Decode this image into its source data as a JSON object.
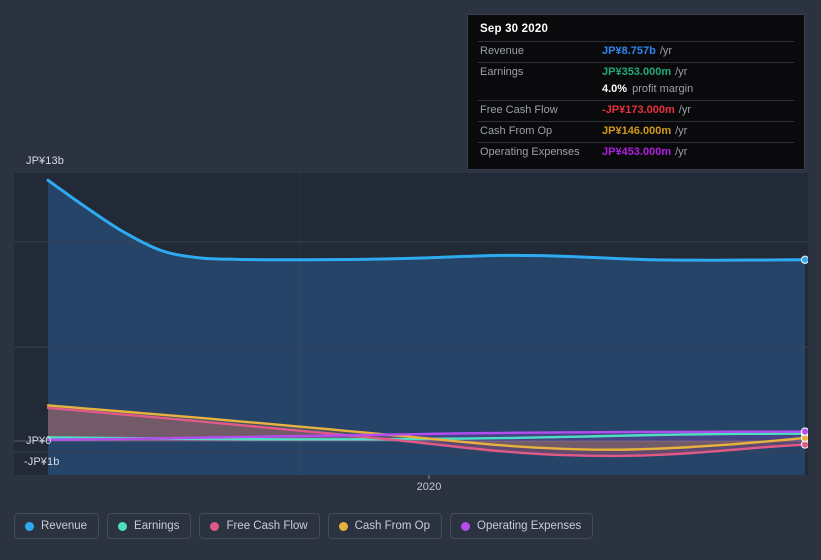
{
  "chart_data": {
    "type": "area",
    "title": "",
    "xlabel": "",
    "ylabel": "",
    "currency": "JP¥",
    "grid": true,
    "legend_position": "bottom",
    "ylim": [
      -1.0,
      13.0
    ],
    "y_ticks": [
      {
        "value": 13.0,
        "label": "JP¥13b"
      },
      {
        "value": 0.0,
        "label": "JP¥0"
      },
      {
        "value": -1.0,
        "label": "-JP¥1b"
      }
    ],
    "x_ticks": [
      {
        "label": "2020"
      }
    ],
    "x_range": [
      "2017",
      "2020-09-30"
    ],
    "series": [
      {
        "name": "Revenue",
        "color": "#2eabf0",
        "fill": "#27456a",
        "unit": "JP¥b",
        "values": [
          12.6,
          11.3,
          10.1,
          9.2,
          8.85,
          8.78,
          8.76,
          8.76,
          8.77,
          8.8,
          8.85,
          8.92,
          8.97,
          8.96,
          8.9,
          8.82,
          8.76,
          8.74,
          8.74,
          8.75,
          8.757
        ]
      },
      {
        "name": "Earnings",
        "color": "#4edfc2",
        "unit": "JP¥b",
        "values": [
          0.18,
          0.16,
          0.14,
          0.12,
          0.1,
          0.09,
          0.08,
          0.08,
          0.08,
          0.09,
          0.1,
          0.12,
          0.14,
          0.17,
          0.21,
          0.25,
          0.29,
          0.32,
          0.34,
          0.35,
          0.353
        ]
      },
      {
        "name": "Free Cash Flow",
        "color": "#e05a87",
        "unit": "JP¥b",
        "values": [
          1.6,
          1.44,
          1.28,
          1.12,
          0.95,
          0.78,
          0.61,
          0.44,
          0.26,
          0.08,
          -0.12,
          -0.32,
          -0.5,
          -0.63,
          -0.7,
          -0.72,
          -0.68,
          -0.58,
          -0.44,
          -0.29,
          -0.173
        ]
      },
      {
        "name": "Cash From Op",
        "color": "#e8b23f",
        "unit": "JP¥b",
        "values": [
          1.72,
          1.57,
          1.42,
          1.27,
          1.12,
          0.96,
          0.8,
          0.64,
          0.47,
          0.3,
          0.13,
          -0.05,
          -0.21,
          -0.33,
          -0.4,
          -0.42,
          -0.38,
          -0.29,
          -0.17,
          -0.02,
          0.146
        ]
      },
      {
        "name": "Operating Expenses",
        "color": "#b44df0",
        "unit": "JP¥b",
        "values": [
          0.06,
          0.08,
          0.1,
          0.13,
          0.16,
          0.19,
          0.22,
          0.25,
          0.28,
          0.31,
          0.34,
          0.37,
          0.39,
          0.41,
          0.42,
          0.43,
          0.44,
          0.44,
          0.45,
          0.45,
          0.453
        ]
      }
    ]
  },
  "tooltip": {
    "date": "Sep 30 2020",
    "rows": [
      {
        "key": "Revenue",
        "value": "JP¥8.757b",
        "unit": "/yr",
        "color": "#2e87f0",
        "sub": ""
      },
      {
        "key": "Earnings",
        "value": "JP¥353.000m",
        "unit": "/yr",
        "color": "#1fa87a",
        "sub": ""
      },
      {
        "key": "",
        "value": "4.0%",
        "unit": "",
        "color": "#ffffff",
        "sub": "profit margin"
      },
      {
        "key": "Free Cash Flow",
        "value": "-JP¥173.000m",
        "unit": "/yr",
        "color": "#e8323c",
        "sub": ""
      },
      {
        "key": "Cash From Op",
        "value": "JP¥146.000m",
        "unit": "/yr",
        "color": "#d29a1a",
        "sub": ""
      },
      {
        "key": "Operating Expenses",
        "value": "JP¥453.000m",
        "unit": "/yr",
        "color": "#b01ee0",
        "sub": ""
      }
    ]
  },
  "axis": {
    "y_top": "JP¥13b",
    "y_zero": "JP¥0",
    "y_neg": "-JP¥1b",
    "x_tick": "2020"
  },
  "legend": {
    "items": [
      {
        "label": "Revenue",
        "color": "#2eabf0"
      },
      {
        "label": "Earnings",
        "color": "#4edfc2"
      },
      {
        "label": "Free Cash Flow",
        "color": "#e05a87"
      },
      {
        "label": "Cash From Op",
        "color": "#e8b23f"
      },
      {
        "label": "Operating Expenses",
        "color": "#b44df0"
      }
    ]
  },
  "colors": {
    "page_background": "#2b3240",
    "plot_background": "#222a37",
    "revenue_fill": "#27456a",
    "gridline": "#3c4454",
    "tooltip_background": "#0a0a0c"
  }
}
